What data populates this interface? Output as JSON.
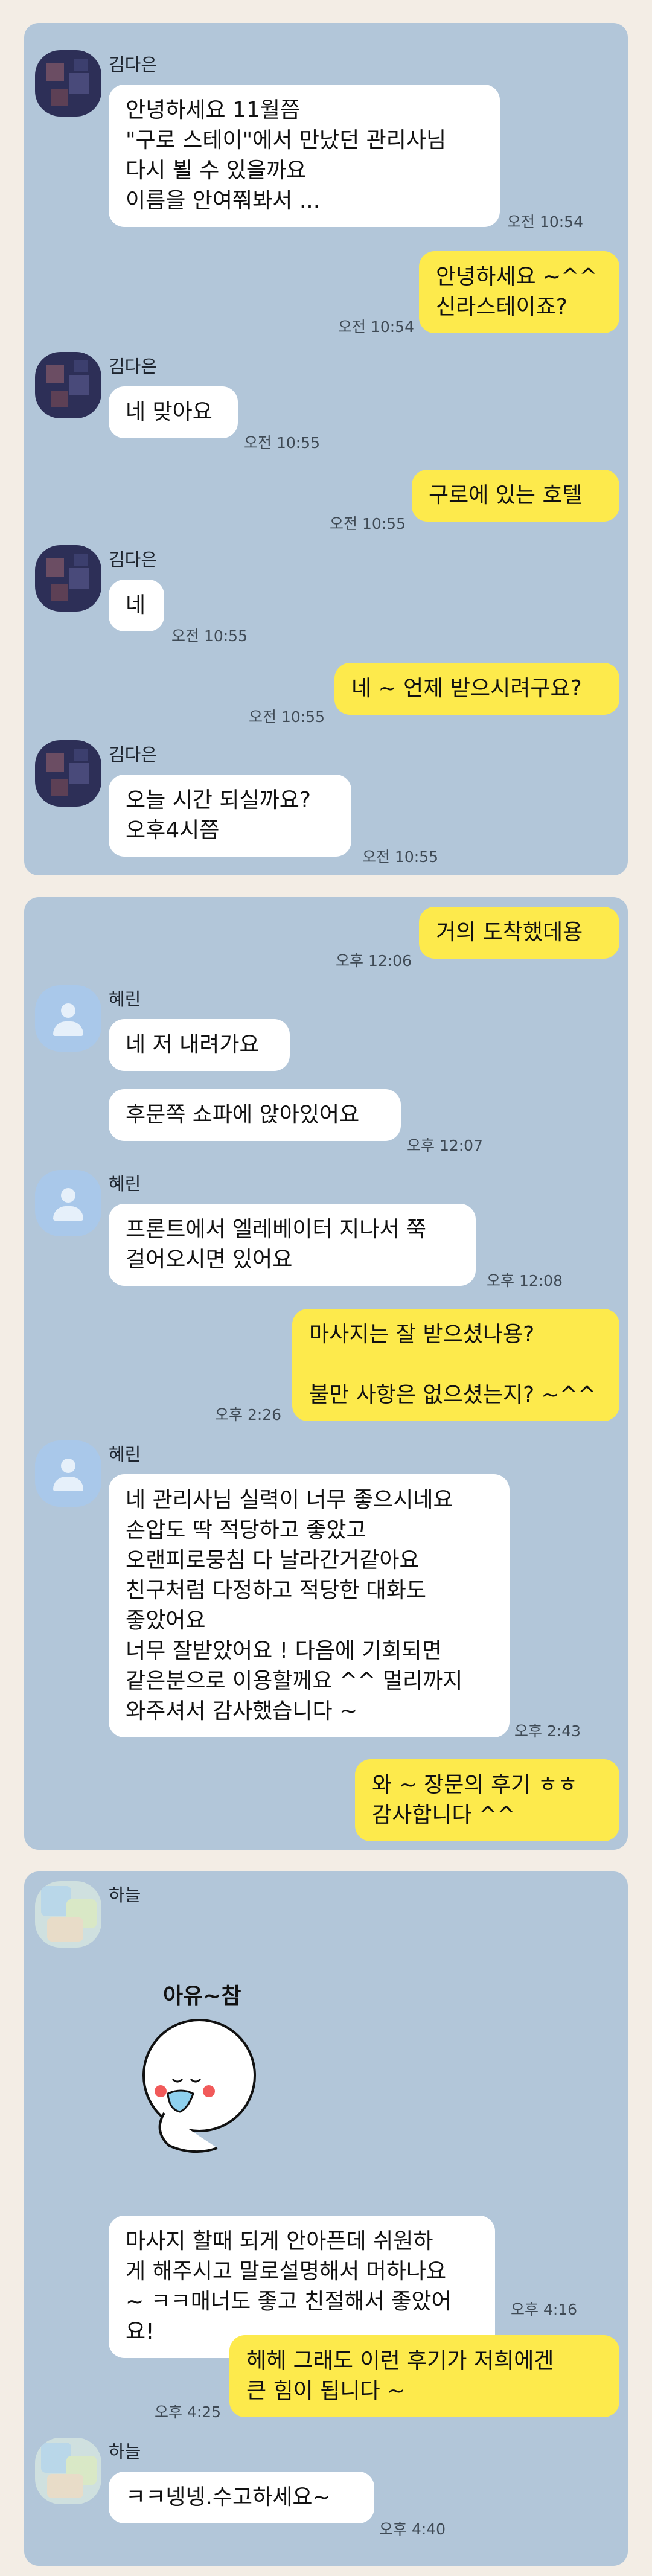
{
  "screenshot1": {
    "messages": [
      {
        "sender": "김다은",
        "text": "안녕하세요 11월쯤\n\"구로 스테이\"에서 만났던 관리사님\n다시 뵐 수 있을까요\n이름을 안여쭤봐서 ...",
        "time": "오전 10:54"
      },
      {
        "sender": "me",
        "text": "안녕하세요 ~^^\n신라스테이죠?",
        "time": "오전 10:54"
      },
      {
        "sender": "김다은",
        "text": "네 맞아요",
        "time": "오전 10:55"
      },
      {
        "sender": "me",
        "text": "구로에 있는 호텔",
        "time": "오전 10:55"
      },
      {
        "sender": "김다은",
        "text": "네",
        "time": "오전 10:55"
      },
      {
        "sender": "me",
        "text": "네 ~ 언제 받으시려구요?",
        "time": "오전 10:55"
      },
      {
        "sender": "김다은",
        "text": "오늘  시간 되실까요?\n오후4시쯤",
        "time": "오전 10:55"
      }
    ]
  },
  "screenshot2": {
    "messages": [
      {
        "sender": "me",
        "text": "거의 도착했데용",
        "time": "오후 12:06"
      },
      {
        "sender": "혜린",
        "text": "네 저 내려가요",
        "time": ""
      },
      {
        "sender": "혜린",
        "text": "후문쪽 쇼파에 앉아있어요",
        "time": "오후 12:07"
      },
      {
        "sender": "혜린",
        "text": "프론트에서 엘레베이터 지나서 쭉\n걸어오시면 있어요",
        "time": "오후 12:08"
      },
      {
        "sender": "me",
        "text": "마사지는 잘 받으셨나용?\n\n불만 사항은 없으셨는지? ~^^",
        "time": "오후 2:26"
      },
      {
        "sender": "혜린",
        "text": "네 관리사님 실력이 너무 좋으시네요\n손압도 딱 적당하고 좋았고\n오랜피로뭉침 다 날라간거같아요\n친구처럼 다정하고 적당한 대화도\n좋았어요\n너무 잘받았어요 ! 다음에 기회되면\n같은분으로 이용할께요 ^^ 멀리까지\n와주셔서 감사했습니다 ~",
        "time": "오후 2:43"
      },
      {
        "sender": "me",
        "text": "와 ~ 장문의 후기 ㅎㅎ\n감사합니다 ^^",
        "time": ""
      }
    ]
  },
  "screenshot3": {
    "sticker_text": "아유~참",
    "messages": [
      {
        "sender": "하늘",
        "text": "마사지 할때 되게 안아픈데 쉬원하\n게 해주시고 말로설명해서 머하나요\n~ ㅋㅋ매너도 좋고 친절해서 좋았어\n요!",
        "time": "오후 4:16"
      },
      {
        "sender": "me",
        "text": "헤헤 그래도 이런 후기가 저희에겐\n큰 힘이 됩니다 ~",
        "time": "오후 4:25"
      },
      {
        "sender": "하늘",
        "text": "ㅋㅋ넹넹.수고하세요~",
        "time": "오후 4:40"
      }
    ]
  },
  "colors": {
    "panel": "#b2c6d9",
    "incoming": "#ffffff",
    "outgoing": "#fdea4c",
    "page": "#f3ede5"
  }
}
